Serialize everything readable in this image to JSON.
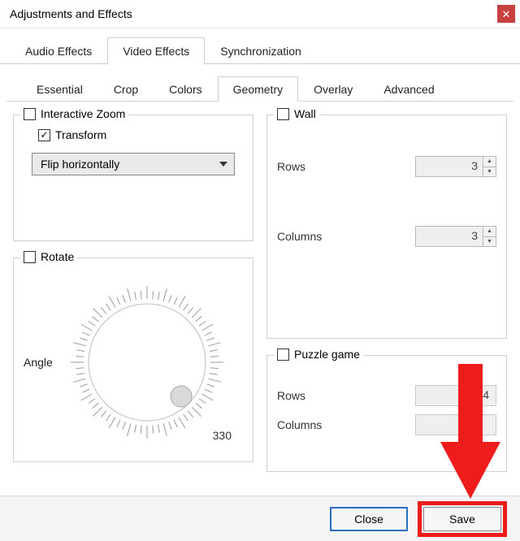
{
  "window": {
    "title": "Adjustments and Effects"
  },
  "top_tabs": {
    "audio": "Audio Effects",
    "video": "Video Effects",
    "sync": "Synchronization"
  },
  "sub_tabs": {
    "essential": "Essential",
    "crop": "Crop",
    "colors": "Colors",
    "geometry": "Geometry",
    "overlay": "Overlay",
    "advanced": "Advanced"
  },
  "geometry": {
    "interactive_zoom": {
      "label": "Interactive Zoom",
      "checked": false
    },
    "transform": {
      "label": "Transform",
      "checked": true,
      "mode": "Flip horizontally"
    },
    "rotate": {
      "label": "Rotate",
      "checked": false,
      "angle_label": "Angle",
      "angle_value": "330"
    },
    "wall": {
      "label": "Wall",
      "checked": false,
      "rows_label": "Rows",
      "rows_value": "3",
      "cols_label": "Columns",
      "cols_value": "3"
    },
    "puzzle": {
      "label": "Puzzle game",
      "checked": false,
      "rows_label": "Rows",
      "rows_value": "4",
      "cols_label": "Columns",
      "cols_value": ""
    }
  },
  "footer": {
    "close": "Close",
    "save": "Save"
  }
}
